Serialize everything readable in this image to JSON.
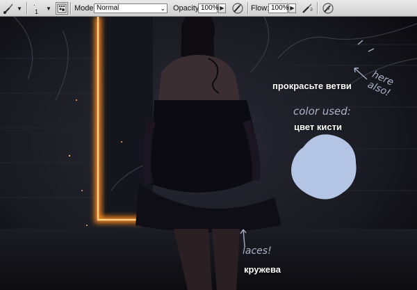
{
  "toolbar": {
    "brush_size": "1",
    "mode_label": "Mode:",
    "mode_value": "Normal",
    "opacity_label": "Opacity:",
    "opacity_value": "100%",
    "flow_label": "Flow:",
    "flow_value": "100%"
  },
  "canvas": {
    "annotation_branches": "прокрасьте ветви",
    "annotation_brush_color": "цвет кисти",
    "annotation_laces": "кружева",
    "handwritten_here_also": "here also!",
    "handwritten_color_used": "color used:",
    "handwritten_laces": "laces!",
    "swatch_color": "#b3c4e4",
    "glow_color": "#ff8a1e"
  }
}
